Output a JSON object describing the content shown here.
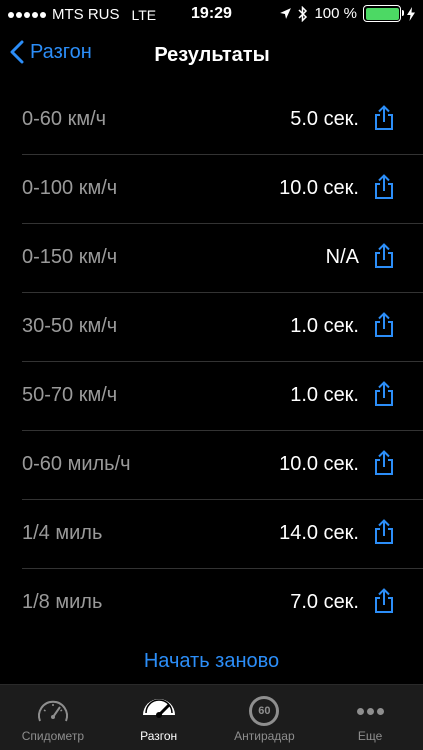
{
  "status_bar": {
    "carrier": "MTS RUS",
    "network": "LTE",
    "time": "19:29",
    "battery_percent": "100 %",
    "battery_level": 1.0
  },
  "navbar": {
    "back_label": "Разгон",
    "title": "Результаты"
  },
  "results": [
    {
      "label": "0-60 км/ч",
      "value": "5.0 сек."
    },
    {
      "label": "0-100 км/ч",
      "value": "10.0 сек."
    },
    {
      "label": "0-150 км/ч",
      "value": "N/A"
    },
    {
      "label": "30-50 км/ч",
      "value": "1.0 сек."
    },
    {
      "label": "50-70 км/ч",
      "value": "1.0 сек."
    },
    {
      "label": "0-60 миль/ч",
      "value": "10.0 сек."
    },
    {
      "label": "1/4 миль",
      "value": "14.0 сек."
    },
    {
      "label": "1/8 миль",
      "value": "7.0 сек."
    }
  ],
  "restart_label": "Начать заново",
  "tabbar": {
    "tabs": [
      {
        "label": "Спидометр",
        "icon": "speedometer-icon",
        "active": false
      },
      {
        "label": "Разгон",
        "icon": "acceleration-icon",
        "active": true
      },
      {
        "label": "Антирадар",
        "icon": "speed-limit-icon",
        "active": false,
        "badge": "60"
      },
      {
        "label": "Еще",
        "icon": "more-icon",
        "active": false
      }
    ]
  },
  "colors": {
    "accent": "#2c8ef8",
    "background": "#000000",
    "label": "#9a9a9a",
    "tabbar": "#1c1c1c",
    "battery": "#4cd964"
  }
}
